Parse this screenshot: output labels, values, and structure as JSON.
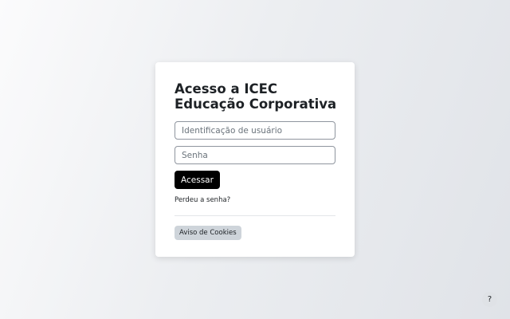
{
  "login": {
    "title_line1": "Acesso a ICEC",
    "title_line2": "Educação Corporativa",
    "username": {
      "placeholder": "Identificação de usuário",
      "value": ""
    },
    "password": {
      "placeholder": "Senha",
      "value": ""
    },
    "login_label": "Acessar",
    "forgot_label": "Perdeu a senha?",
    "cookies_label": "Aviso de Cookies"
  },
  "help": {
    "label": "?",
    "icon": "question-icon"
  },
  "colors": {
    "primary_button": "#000000",
    "secondary_button": "#ced4da",
    "card": "#ffffff",
    "text": "#1d2125"
  }
}
